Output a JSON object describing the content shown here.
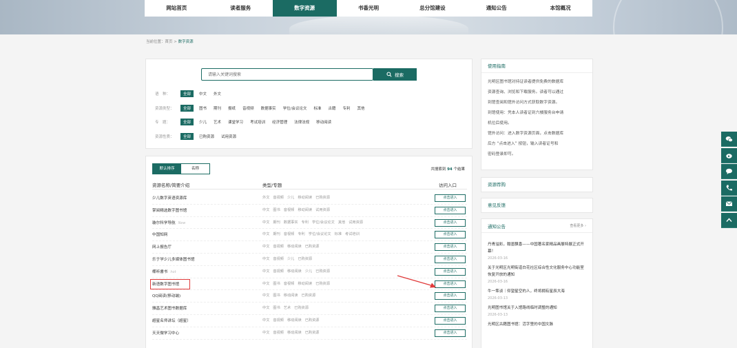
{
  "nav": [
    "网站首页",
    "读者服务",
    "数字资源",
    "书香光明",
    "总分馆建设",
    "通知公告",
    "本馆概况"
  ],
  "nav_active": 2,
  "breadcrumb": {
    "prefix": "当前位置：",
    "home": "首页",
    "sep": " > ",
    "current": "数字资源"
  },
  "search": {
    "placeholder": "请输入关键词搜索",
    "button": "搜索"
  },
  "filters": [
    {
      "label": "语　种：",
      "options": [
        "全部",
        "中文",
        "外文"
      ]
    },
    {
      "label": "资源类型：",
      "options": [
        "全部",
        "图书",
        "期刊",
        "报纸",
        "音视频",
        "数据事实",
        "学位/会议论文",
        "标准",
        "古籍",
        "专利",
        "其他"
      ]
    },
    {
      "label": "专　题：",
      "options": [
        "全部",
        "少儿",
        "艺术",
        "课堂学习",
        "考试培训",
        "经济管理",
        "法律法规",
        "移动阅读"
      ]
    },
    {
      "label": "资源性质：",
      "options": [
        "全部",
        "已购资源",
        "试用资源"
      ]
    }
  ],
  "results": {
    "sort_tabs": [
      "默认排序",
      "名称"
    ],
    "count_prefix": "共搜索到 ",
    "count": "94",
    "count_suffix": " 个结果",
    "headers": {
      "name": "资源名称/简要介绍",
      "type": "类型/专题",
      "access": "访问入口"
    },
    "enter_label": "点击进入",
    "rows": [
      {
        "name": "少儿数字英语资源库",
        "tag": "",
        "cats": [
          "外文",
          "音视频",
          "少儿",
          "移动阅读",
          "已购资源"
        ]
      },
      {
        "name": "掌阅精选数字图书馆",
        "tag": "",
        "cats": [
          "中文",
          "图书",
          "音视频",
          "移动阅读",
          "试用资源"
        ]
      },
      {
        "name": "璇尔科学导航",
        "tag": "New",
        "cats": [
          "中文",
          "期刊",
          "数据事实",
          "专利",
          "学位/会议论文",
          "其他",
          "试用资源"
        ]
      },
      {
        "name": "中国知网",
        "tag": "",
        "cats": [
          "中文",
          "期刊",
          "音视频",
          "专利",
          "学位/会议论文",
          "标准",
          "考试培训"
        ]
      },
      {
        "name": "网上报告厅",
        "tag": "",
        "cats": [
          "中文",
          "音视频",
          "移动阅读",
          "已购资源"
        ]
      },
      {
        "name": "乐于学少儿多媒体图书馆",
        "tag": "",
        "cats": [
          "中文",
          "音视频",
          "少儿",
          "已购资源"
        ]
      },
      {
        "name": "椰听書书",
        "tag": "hot",
        "cats": [
          "中文",
          "音视频",
          "移动阅读",
          "少儿",
          "已购资源"
        ]
      },
      {
        "name": "新语数字图书馆",
        "tag": "",
        "cats": [
          "中文",
          "图书",
          "音视频",
          "移动阅读",
          "已购资源"
        ]
      },
      {
        "name": "QQ阅读(移动端)",
        "tag": "",
        "cats": [
          "中文",
          "图书",
          "移动阅读",
          "已购资源"
        ]
      },
      {
        "name": "雅昌艺术图书数据库",
        "tag": "",
        "cats": [
          "中文",
          "图书",
          "艺术",
          "已购资源"
        ]
      },
      {
        "name": "超星名师讲坛（超星）",
        "tag": "",
        "cats": [
          "中文",
          "音视频",
          "移动阅读",
          "已购资源"
        ]
      },
      {
        "name": "天天微学习中心",
        "tag": "",
        "cats": [
          "中文",
          "音视频",
          "移动阅读",
          "已购资源"
        ]
      }
    ]
  },
  "guide": {
    "title": "使用指南",
    "lines": [
      "光明区图书馆对持证读者提供免费的数据库",
      "资源查询、浏览和下载服务。读者可以通过",
      "到馆查阅和馆外访问方式获取数字资源。",
      "到馆使用：凭本人读者证到六楼服务台申请",
      "机位后使用。",
      "馆外访问：进入数字资源页面，点击数据库",
      "后方 “点击进入” 按钮，输入读者证号和",
      "密码登录即可。"
    ]
  },
  "side_links": [
    "资源荐购",
    "意见反馈"
  ],
  "notices": {
    "title": "通知公告",
    "more": "查看更多 ›",
    "items": [
      {
        "title": "丹青溢彩，翰墨飘香——中国著名家精品画展特展正式开幕！",
        "date": "2026-03-16"
      },
      {
        "title": "关于光明区光明街道白花社区综合性文化服务中心功能室恢复开放的通知",
        "date": "2026-03-16"
      },
      {
        "title": "牛一隼谈｜仰望星空的人，终将拥有星辰大海",
        "date": "2026-03-13"
      },
      {
        "title": "光明图书馆关于入馆路线临时调整的通知",
        "date": "2026-03-13"
      },
      {
        "title": "光明区古籍图书馆：活字里的中国文脉",
        "date": ""
      }
    ]
  },
  "float_icons": [
    "wechat-icon",
    "weibo-icon",
    "chat-icon",
    "phone-icon",
    "mail-icon",
    "back-to-top-icon"
  ],
  "colors": {
    "primary": "#1b6b63",
    "highlight": "#e03a3a"
  }
}
